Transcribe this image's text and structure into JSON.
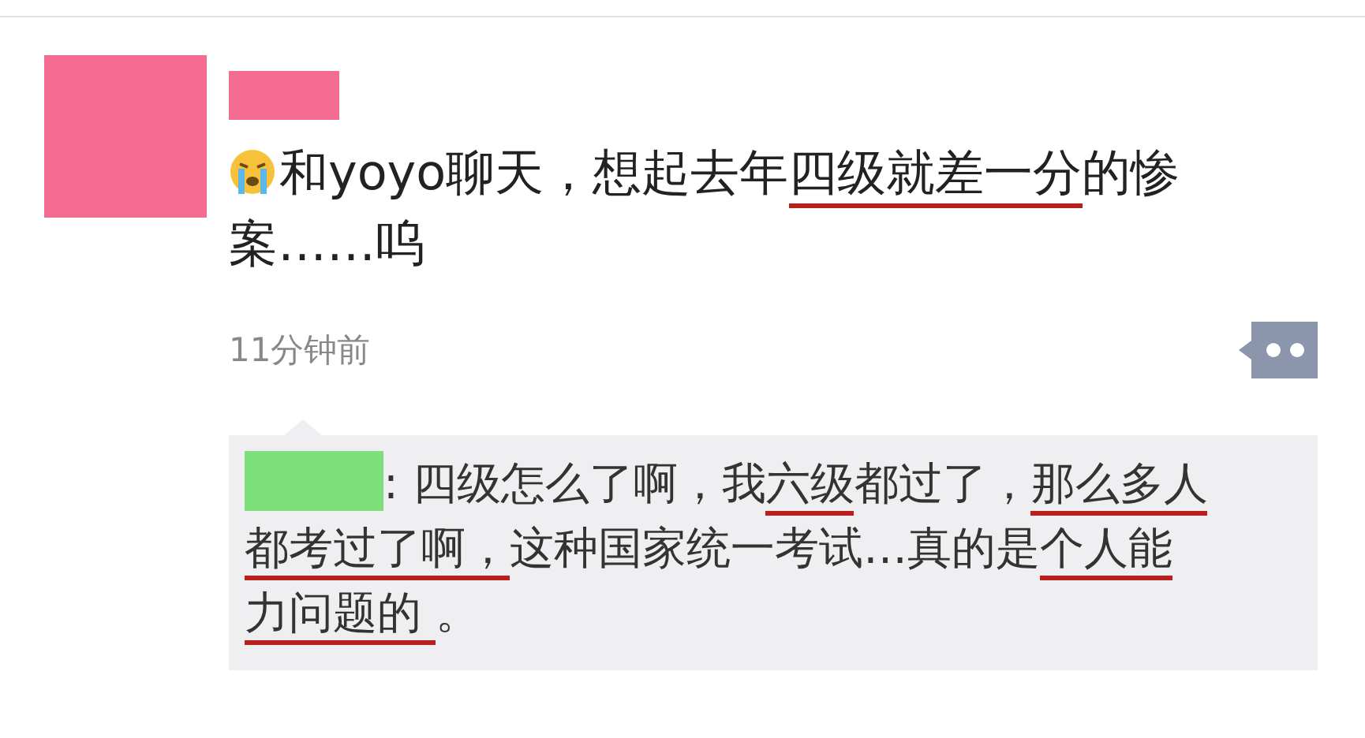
{
  "post": {
    "text": [
      {
        "text": "和yoyo聊天，想起去年",
        "underlined": false
      },
      {
        "text": "四级就差一分",
        "underlined": true
      },
      {
        "text": "的惨案……呜",
        "underlined": false
      }
    ],
    "time": "11分钟前"
  },
  "comments": [
    {
      "text": [
        {
          "text": ": 四级怎么了啊，我",
          "underlined": false
        },
        {
          "text": "六级",
          "underlined": true
        },
        {
          "text": "都过了，",
          "underlined": false
        },
        {
          "text": "那么多人都考过了啊，",
          "underlined": true
        },
        {
          "text": "这种国家统一考试…真的是",
          "underlined": false
        },
        {
          "text": "个人能力问题的 ",
          "underlined": true
        },
        {
          "text": "。",
          "underlined": false
        }
      ]
    }
  ]
}
